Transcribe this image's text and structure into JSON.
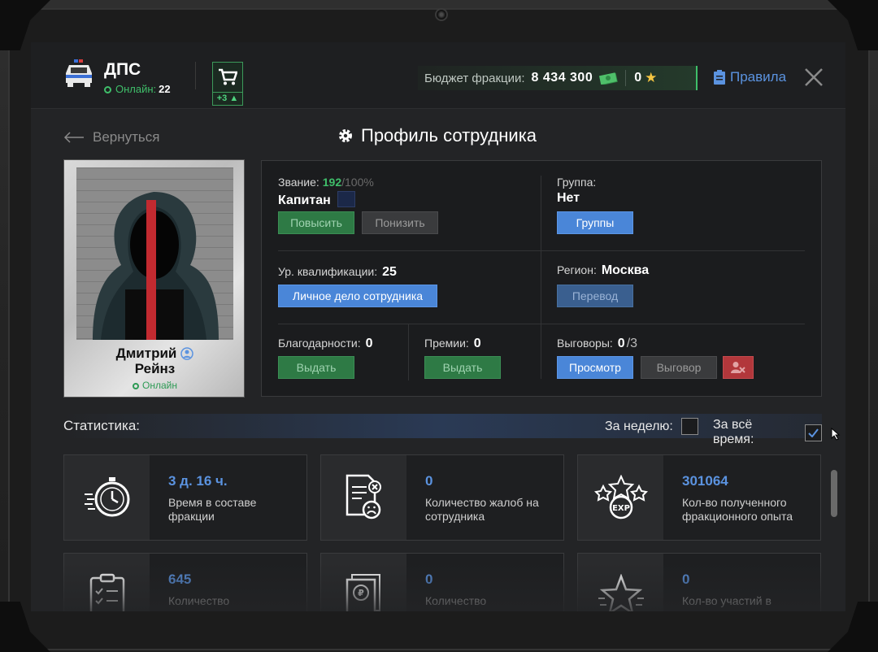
{
  "header": {
    "faction_name": "ДПС",
    "online_label": "Онлайн:",
    "online_count": "22",
    "cart_badge": "+3",
    "budget_label": "Бюджет фракции:",
    "budget_value": "8 434 300",
    "stars_value": "0",
    "rules_label": "Правила"
  },
  "nav": {
    "back_label": "Вернуться",
    "page_title": "Профиль сотрудника"
  },
  "profile": {
    "first_name": "Дмитрий",
    "last_name": "Рейнз",
    "status": "Онлайн"
  },
  "info": {
    "rank_label": "Звание:",
    "rank_progress": "192",
    "rank_progress_max": "/100%",
    "rank_name": "Капитан",
    "promote_button": "Повысить",
    "demote_button": "Понизить",
    "group_label": "Группа:",
    "group_value": "Нет",
    "groups_button": "Группы",
    "qualification_label": "Ур. квалификации:",
    "qualification_value": "25",
    "personal_file_button": "Личное дело сотрудника",
    "region_label": "Регион:",
    "region_value": "Москва",
    "transfer_button": "Перевод",
    "thanks_label": "Благодарности:",
    "thanks_value": "0",
    "thanks_button": "Выдать",
    "bonus_label": "Премии:",
    "bonus_value": "0",
    "bonus_button": "Выдать",
    "reprimands_label": "Выговоры:",
    "reprimands_value": "0",
    "reprimands_max": "/3",
    "view_button": "Просмотр",
    "reprimand_button": "Выговор"
  },
  "stats": {
    "title": "Статистика:",
    "week_label": "За неделю:",
    "week_checked": false,
    "all_time_label": "За всё время:",
    "all_time_checked": true,
    "cards": [
      {
        "value": "3 д. 16 ч.",
        "desc": "Время в составе фракции",
        "icon": "stopwatch-icon"
      },
      {
        "value": "0",
        "desc": "Количество жалоб на сотрудника",
        "icon": "complaint-icon"
      },
      {
        "value": "301064",
        "desc": "Кол-во полученного фракционного опыта",
        "icon": "exp-stars-icon"
      },
      {
        "value": "645",
        "desc": "Количество",
        "icon": "clipboard-icon"
      },
      {
        "value": "0",
        "desc": "Количество",
        "icon": "ruble-document-icon"
      },
      {
        "value": "0",
        "desc": "Кол-во участий в",
        "icon": "star-icon"
      }
    ]
  },
  "colors": {
    "accent_green": "#3fbf6a",
    "accent_blue": "#5b93e0",
    "danger_red": "#b2373b"
  }
}
